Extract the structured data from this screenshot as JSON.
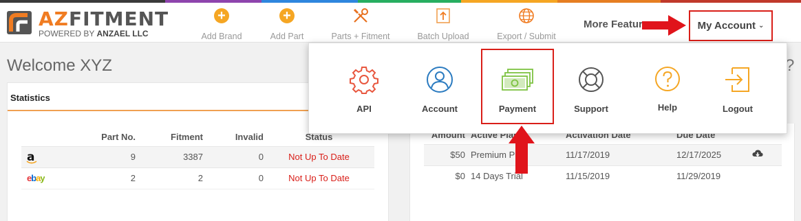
{
  "brand": {
    "logo_prefix": "AZ",
    "logo_rest": "FITMENT",
    "tagline_prefix": "POWERED BY",
    "tagline_company": "ANZAEL LLC"
  },
  "colors": {
    "stripe": [
      "#3a3a3a",
      "#8e44ad",
      "#2e86de",
      "#27ae60",
      "#f5a623",
      "#e67e22",
      "#c0392b"
    ],
    "accent": "#f07c22",
    "alert": "#d91e18"
  },
  "nav": {
    "items": [
      {
        "label": "Add Brand",
        "icon": "plus-circle-icon"
      },
      {
        "label": "Add Part",
        "icon": "plus-circle-icon"
      },
      {
        "label": "Parts + Fitment",
        "icon": "tools-icon"
      },
      {
        "label": "Batch Upload",
        "icon": "upload-icon"
      },
      {
        "label": "Export / Submit",
        "icon": "globe-icon"
      }
    ],
    "more_features": "More Features",
    "my_account": "My Account"
  },
  "welcome": "Welcome XYZ",
  "help_mark": "?",
  "stats": {
    "title": "Statistics",
    "columns": [
      "",
      "Part No.",
      "Fitment",
      "Invalid",
      "Status"
    ],
    "rows": [
      {
        "channel_icon": "amazon-logo",
        "logo_text": "a",
        "part_no": "9",
        "fitment": "3387",
        "invalid": "0",
        "status": "Not Up To Date"
      },
      {
        "channel_icon": "ebay-logo",
        "logo_text": "ebay",
        "part_no": "2",
        "fitment": "2",
        "invalid": "0",
        "status": "Not Up To Date"
      }
    ]
  },
  "plans": {
    "columns": [
      "Amount",
      "Active Plan",
      "Activation Date",
      "Due Date"
    ],
    "rows": [
      {
        "amount": "$50",
        "plan": "Premium Plan",
        "activation": "11/17/2019",
        "due": "12/17/2025",
        "action_icon": "cloud-download-icon"
      },
      {
        "amount": "$0",
        "plan": "14 Days Trial",
        "activation": "11/15/2019",
        "due": "11/29/2019"
      }
    ]
  },
  "account_menu": {
    "items": [
      {
        "label": "API",
        "icon": "gear-icon"
      },
      {
        "label": "Account",
        "icon": "user-icon"
      },
      {
        "label": "Payment",
        "icon": "money-icon"
      },
      {
        "label": "Support",
        "icon": "lifebuoy-icon"
      },
      {
        "label": "Help",
        "icon": "question-icon"
      },
      {
        "label": "Logout",
        "icon": "logout-icon"
      }
    ]
  }
}
